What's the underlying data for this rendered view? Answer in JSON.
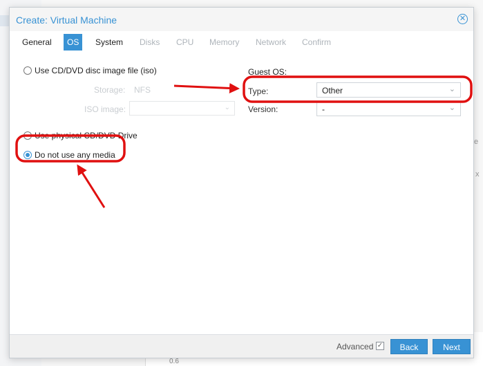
{
  "dialog": {
    "title": "Create: Virtual Machine",
    "close_icon": "close-circle-icon"
  },
  "tabs": [
    {
      "label": "General",
      "state": "enabled"
    },
    {
      "label": "OS",
      "state": "active"
    },
    {
      "label": "System",
      "state": "enabled"
    },
    {
      "label": "Disks",
      "state": "disabled"
    },
    {
      "label": "CPU",
      "state": "disabled"
    },
    {
      "label": "Memory",
      "state": "disabled"
    },
    {
      "label": "Network",
      "state": "disabled"
    },
    {
      "label": "Confirm",
      "state": "disabled"
    }
  ],
  "media": {
    "option_iso": "Use CD/DVD disc image file (iso)",
    "storage_label": "Storage:",
    "storage_value": "NFS",
    "iso_label": "ISO image:",
    "option_physical": "Use physical CD/DVD Drive",
    "option_none": "Do not use any media",
    "selected": "none"
  },
  "guest_os": {
    "title": "Guest OS:",
    "type_label": "Type:",
    "type_value": "Other",
    "version_label": "Version:",
    "version_value": "-"
  },
  "footer": {
    "advanced_label": "Advanced",
    "back_label": "Back",
    "next_label": "Next"
  },
  "background": {
    "tick_label": "0.6",
    "right_text_1": "e",
    "right_text_2": "x"
  },
  "colors": {
    "accent": "#3892d4",
    "annotation": "#e01010"
  }
}
